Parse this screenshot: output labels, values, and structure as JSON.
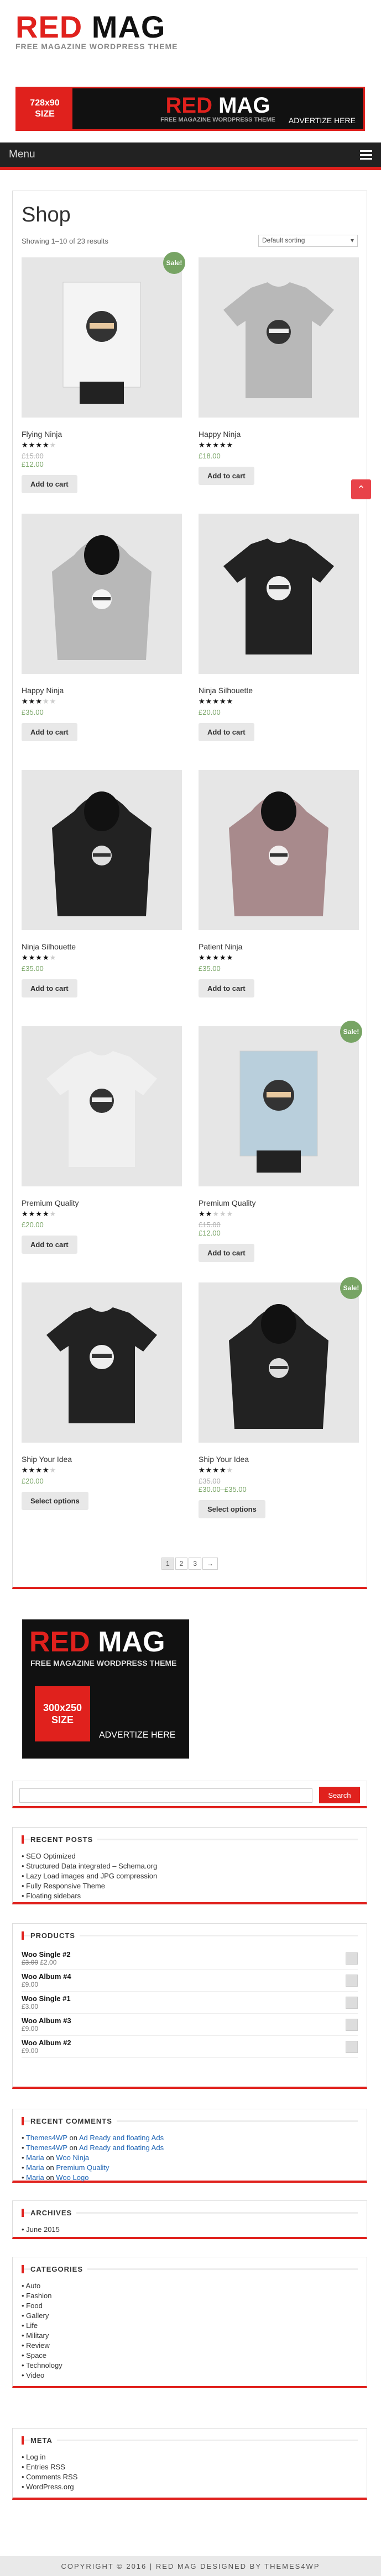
{
  "logo": {
    "red": "RED",
    "black": " MAG",
    "tagline": "FREE MAGAZINE WORDPRESS THEME"
  },
  "banner": {
    "size1": "728x90",
    "size2": "SIZE",
    "title_red": "RED",
    "title_white": " MAG",
    "subtitle": "FREE MAGAZINE WORDPRESS THEME",
    "advertise": "ADVERTIZE HERE"
  },
  "nav": {
    "menu_label": "Menu"
  },
  "shop": {
    "title": "Shop",
    "result_count": "Showing 1–10 of 23 results",
    "sort": "Default sorting",
    "products": [
      {
        "name": "Flying Ninja",
        "stars": 4,
        "old": "£15.00",
        "price": "£12.00",
        "sale": "Sale!",
        "button": "Add to cart",
        "kind": "poster"
      },
      {
        "name": "Happy Ninja",
        "stars": 5,
        "old": "",
        "price": "£18.00",
        "sale": "",
        "button": "Add to cart",
        "kind": "tee-grey"
      },
      {
        "name": "Happy Ninja",
        "stars": 3,
        "old": "",
        "price": "£35.00",
        "sale": "",
        "button": "Add to cart",
        "kind": "hoodie-grey"
      },
      {
        "name": "Ninja Silhouette",
        "stars": 5,
        "old": "",
        "price": "£20.00",
        "sale": "",
        "button": "Add to cart",
        "kind": "tee-black"
      },
      {
        "name": "Ninja Silhouette",
        "stars": 4,
        "old": "",
        "price": "£35.00",
        "sale": "",
        "button": "Add to cart",
        "kind": "hoodie-black"
      },
      {
        "name": "Patient Ninja",
        "stars": 5,
        "old": "",
        "price": "£35.00",
        "sale": "",
        "button": "Add to cart",
        "kind": "hoodie-pink"
      },
      {
        "name": "Premium Quality",
        "stars": 4,
        "old": "",
        "price": "£20.00",
        "sale": "",
        "button": "Add to cart",
        "kind": "tee-white"
      },
      {
        "name": "Premium Quality",
        "stars": 2,
        "old": "£15.00",
        "price": "£12.00",
        "sale": "Sale!",
        "button": "Add to cart",
        "kind": "poster-blue"
      },
      {
        "name": "Ship Your Idea",
        "stars": 4,
        "old": "",
        "price": "£20.00",
        "sale": "",
        "button": "Select options",
        "kind": "tee-skull"
      },
      {
        "name": "Ship Your Idea",
        "stars": 4,
        "old": "£35.00",
        "price": "£30.00–£35.00",
        "sale": "Sale!",
        "button": "Select options",
        "kind": "hoodie-skull"
      }
    ],
    "pages": [
      "1",
      "2",
      "3",
      "→"
    ]
  },
  "ad300": {
    "title_red": "RED",
    "title_white": " MAG",
    "subtitle": "FREE MAGAZINE WORDPRESS THEME",
    "size1": "300x250",
    "size2": "SIZE",
    "advertise": "ADVERTIZE HERE"
  },
  "search": {
    "button": "Search"
  },
  "recent_posts": {
    "title": "RECENT POSTS",
    "items": [
      "SEO Optimized",
      "Structured Data integrated – Schema.org",
      "Lazy Load images and JPG compression",
      "Fully Responsive Theme",
      "Floating sidebars"
    ]
  },
  "products": {
    "title": "PRODUCTS",
    "items": [
      {
        "name": "Woo Single #2",
        "old": "£3.00",
        "price": "£2.00"
      },
      {
        "name": "Woo Album #4",
        "old": "",
        "price": "£9.00"
      },
      {
        "name": "Woo Single #1",
        "old": "",
        "price": "£3.00"
      },
      {
        "name": "Woo Album #3",
        "old": "",
        "price": "£9.00"
      },
      {
        "name": "Woo Album #2",
        "old": "",
        "price": "£9.00"
      }
    ]
  },
  "recent_comments": {
    "title": "RECENT COMMENTS",
    "items": [
      {
        "who": "Themes4WP",
        "on": "on",
        "what": "Ad Ready and floating Ads"
      },
      {
        "who": "Themes4WP",
        "on": "on",
        "what": "Ad Ready and floating Ads"
      },
      {
        "who": "Maria",
        "on": "on",
        "what": "Woo Ninja"
      },
      {
        "who": "Maria",
        "on": "on",
        "what": "Premium Quality"
      },
      {
        "who": "Maria",
        "on": "on",
        "what": "Woo Logo"
      }
    ]
  },
  "archives": {
    "title": "ARCHIVES",
    "items": [
      "June 2015"
    ]
  },
  "categories": {
    "title": "CATEGORIES",
    "items": [
      "Auto",
      "Fashion",
      "Food",
      "Gallery",
      "Life",
      "Military",
      "Review",
      "Space",
      "Technology",
      "Video"
    ]
  },
  "meta": {
    "title": "META",
    "items": [
      "Log in",
      "Entries RSS",
      "Comments RSS",
      "WordPress.org"
    ]
  },
  "footer": {
    "text": "COPYRIGHT © 2016 | RED MAG DESIGNED BY THEMES4WP"
  },
  "colors": {
    "accent": "#e0211d",
    "sale": "#77a464"
  }
}
